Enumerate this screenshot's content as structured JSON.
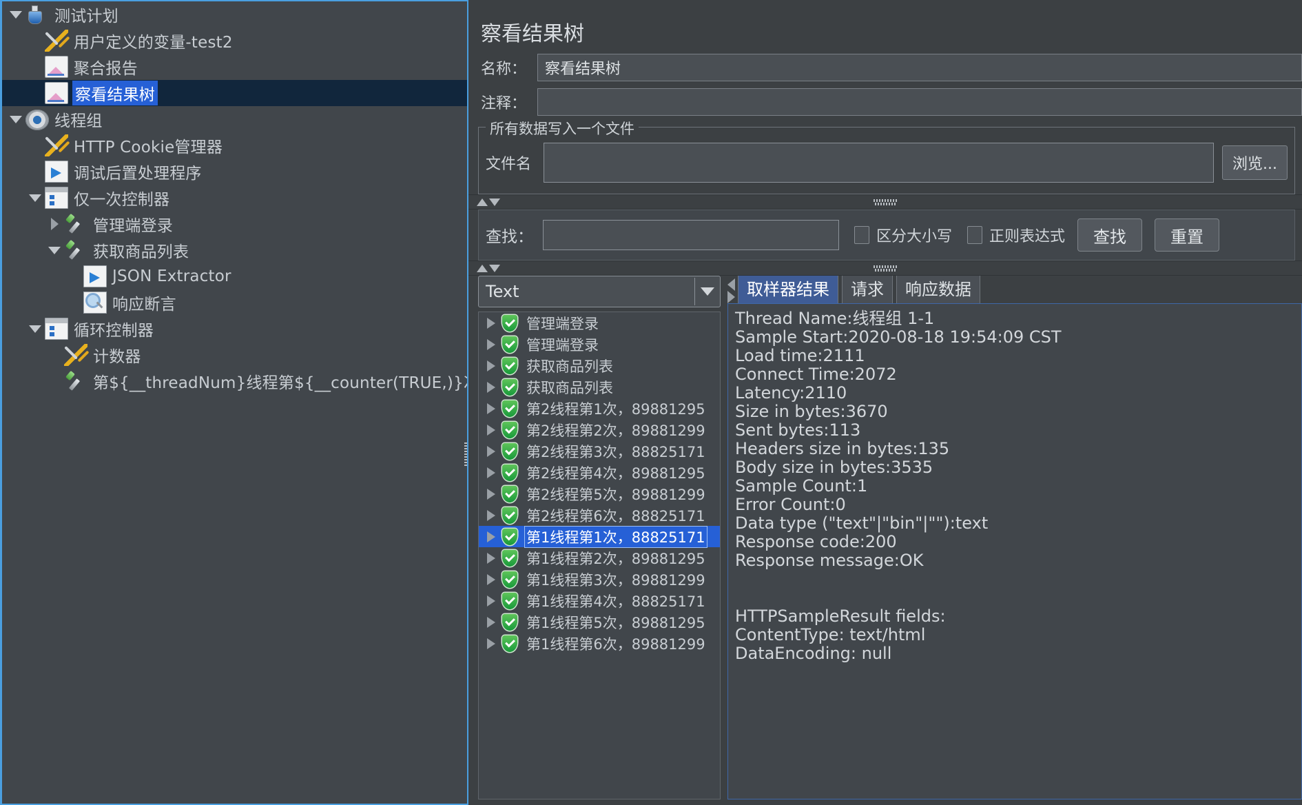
{
  "tree": {
    "items": [
      {
        "label": "测试计划",
        "indent": 0,
        "toggle": "down",
        "icon": "flask-icon",
        "selected": false
      },
      {
        "label": "用户定义的变量-test2",
        "indent": 1,
        "toggle": "none",
        "icon": "wrench-icon",
        "selected": false
      },
      {
        "label": "聚合报告",
        "indent": 1,
        "toggle": "none",
        "icon": "chart-icon",
        "selected": false
      },
      {
        "label": "察看结果树",
        "indent": 1,
        "toggle": "none",
        "icon": "chart-icon",
        "selected": true
      },
      {
        "label": "线程组",
        "indent": 0,
        "toggle": "down",
        "icon": "gear-icon",
        "selected": false
      },
      {
        "label": "HTTP Cookie管理器",
        "indent": 1,
        "toggle": "none",
        "icon": "wrench-icon",
        "selected": false
      },
      {
        "label": "调试后置处理程序",
        "indent": 1,
        "toggle": "none",
        "icon": "document-arrow-icon",
        "selected": false
      },
      {
        "label": "仅一次控制器",
        "indent": 1,
        "toggle": "down",
        "icon": "controller-icon",
        "selected": false
      },
      {
        "label": "管理端登录",
        "indent": 2,
        "toggle": "right",
        "icon": "pipette-icon",
        "selected": false
      },
      {
        "label": "获取商品列表",
        "indent": 2,
        "toggle": "down",
        "icon": "pipette-icon",
        "selected": false
      },
      {
        "label": "JSON Extractor",
        "indent": 3,
        "toggle": "none",
        "icon": "document-arrow-icon",
        "selected": false
      },
      {
        "label": "响应断言",
        "indent": 3,
        "toggle": "none",
        "icon": "magnifier-icon",
        "selected": false
      },
      {
        "label": "循环控制器",
        "indent": 1,
        "toggle": "down",
        "icon": "controller-icon",
        "selected": false
      },
      {
        "label": "计数器",
        "indent": 2,
        "toggle": "none",
        "icon": "wrench-icon",
        "selected": false
      },
      {
        "label": "第${__threadNum}线程第${__counter(TRUE,)}次,",
        "indent": 2,
        "toggle": "none",
        "icon": "pipette-icon",
        "selected": false
      }
    ]
  },
  "main": {
    "title": "察看结果树",
    "name_label": "名称：",
    "name_value": "察看结果树",
    "comment_label": "注释：",
    "comment_value": "",
    "file_group_legend": "所有数据写入一个文件",
    "file_label": "文件名",
    "file_value": "",
    "browse_button": "浏览..."
  },
  "search": {
    "label": "查找：",
    "value": "",
    "case_sensitive_label": "区分大小写",
    "regex_label": "正则表达式",
    "find_button": "查找",
    "reset_button": "重置"
  },
  "renderer": {
    "selected": "Text"
  },
  "results": [
    {
      "label": "管理端登录",
      "status": "success",
      "selected": false
    },
    {
      "label": "管理端登录",
      "status": "success",
      "selected": false
    },
    {
      "label": "获取商品列表",
      "status": "success",
      "selected": false
    },
    {
      "label": "获取商品列表",
      "status": "success",
      "selected": false
    },
    {
      "label": "第2线程第1次，89881295",
      "status": "success",
      "selected": false
    },
    {
      "label": "第2线程第2次，89881299",
      "status": "success",
      "selected": false
    },
    {
      "label": "第2线程第3次，88825171",
      "status": "success",
      "selected": false
    },
    {
      "label": "第2线程第4次，89881295",
      "status": "success",
      "selected": false
    },
    {
      "label": "第2线程第5次，89881299",
      "status": "success",
      "selected": false
    },
    {
      "label": "第2线程第6次，88825171",
      "status": "success",
      "selected": false
    },
    {
      "label": "第1线程第1次，88825171",
      "status": "success",
      "selected": true
    },
    {
      "label": "第1线程第2次，89881295",
      "status": "success",
      "selected": false
    },
    {
      "label": "第1线程第3次，89881299",
      "status": "success",
      "selected": false
    },
    {
      "label": "第1线程第4次，88825171",
      "status": "success",
      "selected": false
    },
    {
      "label": "第1线程第5次，89881295",
      "status": "success",
      "selected": false
    },
    {
      "label": "第1线程第6次，89881299",
      "status": "success",
      "selected": false
    }
  ],
  "tabs": [
    {
      "label": "取样器结果",
      "active": true
    },
    {
      "label": "请求",
      "active": false
    },
    {
      "label": "响应数据",
      "active": false
    }
  ],
  "detail": {
    "lines": [
      "Thread Name:线程组 1-1",
      "Sample Start:2020-08-18 19:54:09 CST",
      "Load time:2111",
      "Connect Time:2072",
      "Latency:2110",
      "Size in bytes:3670",
      "Sent bytes:113",
      "Headers size in bytes:135",
      "Body size in bytes:3535",
      "Sample Count:1",
      "Error Count:0",
      "Data type (\"text\"|\"bin\"|\"\"):text",
      "Response code:200",
      "Response message:OK",
      "",
      "",
      "HTTPSampleResult fields:",
      "ContentType: text/html",
      "DataEncoding: null"
    ]
  },
  "colors": {
    "accent": "#2660d6",
    "panel_bg": "#3c4043",
    "tree_bg": "#41464b",
    "border_focus": "#4a9fe0",
    "success": "#189a3a"
  }
}
